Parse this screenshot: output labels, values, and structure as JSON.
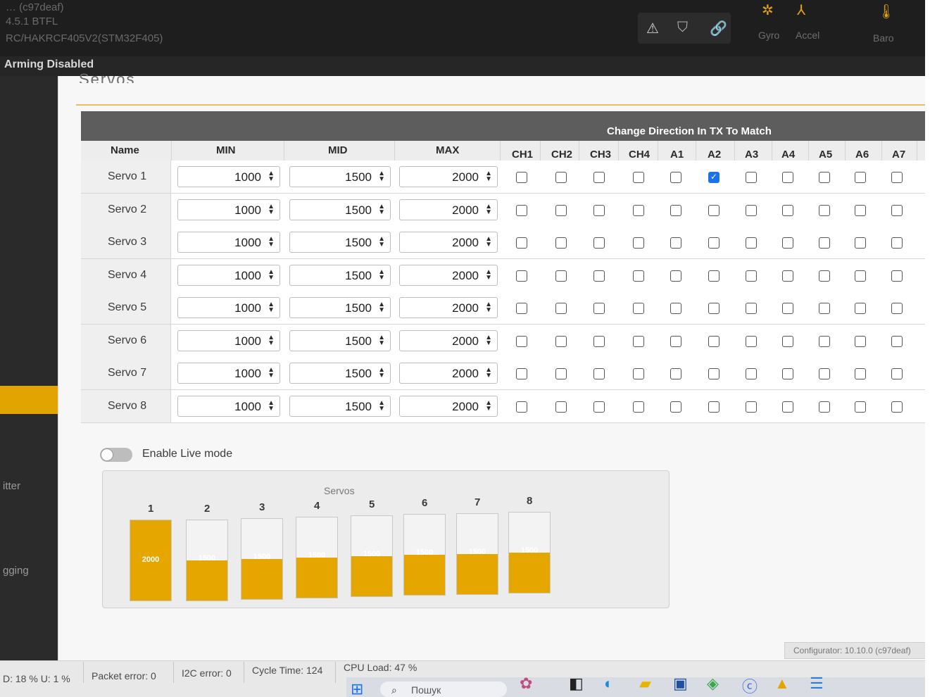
{
  "header": {
    "line1": "… (c97deaf)",
    "line2": "4.5.1 BTFL",
    "line3": "RC/HAKRCF405V2(STM32F405)",
    "sensors": [
      "Gyro",
      "Accel",
      "Baro"
    ],
    "icons": [
      "warning-icon",
      "parachute-icon",
      "link-icon",
      "gyro-icon",
      "accel-icon",
      "baro-icon"
    ]
  },
  "status": {
    "arming": "Arming Disabled"
  },
  "sidebar": {
    "items": [
      "itter",
      "gging"
    ]
  },
  "servos": {
    "title": "Servos",
    "tx_header": "Change Direction In TX To Match",
    "columns": [
      "Name",
      "MIN",
      "MID",
      "MAX",
      "CH1",
      "CH2",
      "CH3",
      "CH4",
      "A1",
      "A2",
      "A3",
      "A4",
      "A5",
      "A6",
      "A7"
    ],
    "rows": [
      {
        "name": "Servo 1",
        "min": "1000",
        "mid": "1500",
        "max": "2000",
        "checked": [
          "A2"
        ]
      },
      {
        "name": "Servo 2",
        "min": "1000",
        "mid": "1500",
        "max": "2000",
        "checked": []
      },
      {
        "name": "Servo 3",
        "min": "1000",
        "mid": "1500",
        "max": "2000",
        "checked": []
      },
      {
        "name": "Servo 4",
        "min": "1000",
        "mid": "1500",
        "max": "2000",
        "checked": []
      },
      {
        "name": "Servo 5",
        "min": "1000",
        "mid": "1500",
        "max": "2000",
        "checked": []
      },
      {
        "name": "Servo 6",
        "min": "1000",
        "mid": "1500",
        "max": "2000",
        "checked": []
      },
      {
        "name": "Servo 7",
        "min": "1000",
        "mid": "1500",
        "max": "2000",
        "checked": []
      },
      {
        "name": "Servo 8",
        "min": "1000",
        "mid": "1500",
        "max": "2000",
        "checked": []
      }
    ]
  },
  "live_mode": {
    "label": "Enable Live mode",
    "enabled": false
  },
  "servo_bars": {
    "title": "Servos",
    "range": [
      1000,
      2000
    ],
    "items": [
      {
        "label": "1",
        "value": 2000,
        "value_text": "2000"
      },
      {
        "label": "2",
        "value": 1500,
        "value_text": "1500"
      },
      {
        "label": "3",
        "value": 1500,
        "value_text": "1500"
      },
      {
        "label": "4",
        "value": 1500,
        "value_text": "1500"
      },
      {
        "label": "5",
        "value": 1500,
        "value_text": "1500"
      },
      {
        "label": "6",
        "value": 1500,
        "value_text": "1500"
      },
      {
        "label": "7",
        "value": 1500,
        "value_text": "1500"
      },
      {
        "label": "8",
        "value": 1500,
        "value_text": "1500"
      }
    ],
    "fill_color": "#e5a600"
  },
  "footer": {
    "load": "D: 18 % U: 1 %",
    "packet_error": "Packet error: 0",
    "i2c_error": "I2C error: 0",
    "cycle_time": "Cycle Time: 124",
    "cpu_load": "CPU Load: 47 %",
    "configurator": "Configurator: 10.10.0 (c97deaf)"
  },
  "taskbar": {
    "search_placeholder": "Пошук"
  },
  "colors": {
    "accent": "#e2a400",
    "checkbox_checked": "#1a73e8",
    "table_header": "#5d5d5d"
  }
}
